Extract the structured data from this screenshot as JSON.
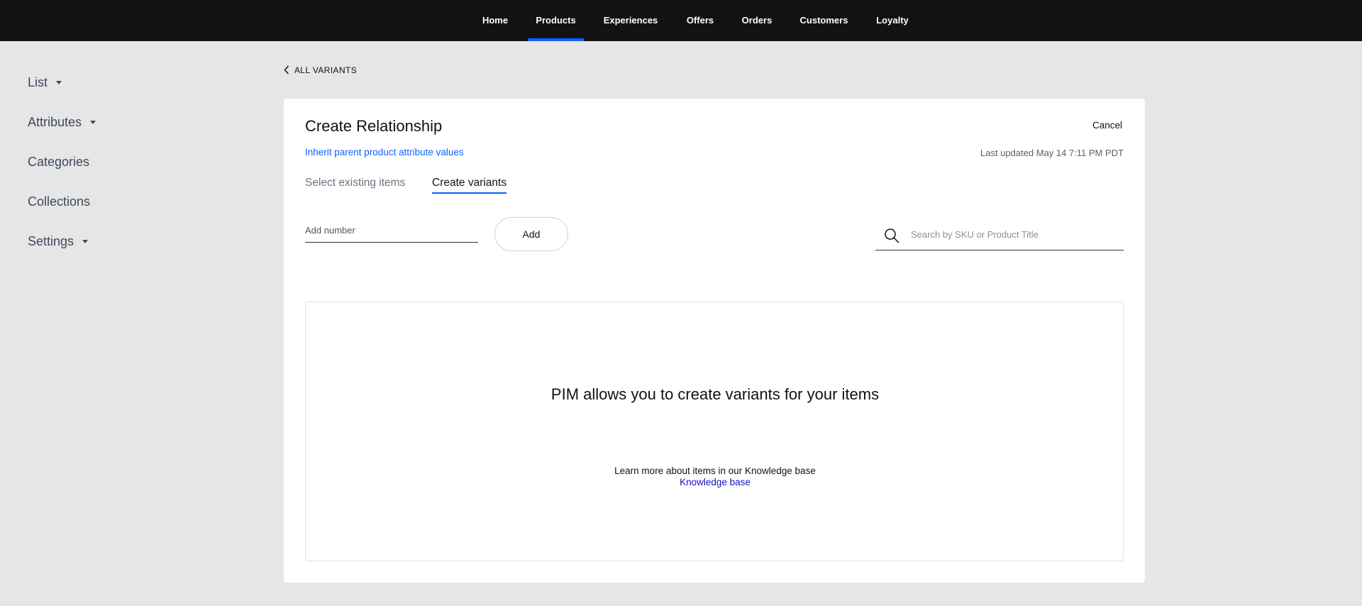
{
  "topnav": {
    "items": [
      {
        "label": "Home"
      },
      {
        "label": "Products",
        "active": true
      },
      {
        "label": "Experiences"
      },
      {
        "label": "Offers"
      },
      {
        "label": "Orders"
      },
      {
        "label": "Customers"
      },
      {
        "label": "Loyalty"
      }
    ],
    "active_color": "#0d62ff"
  },
  "sidebar": {
    "items": [
      {
        "label": "List",
        "has_dropdown": true
      },
      {
        "label": "Attributes",
        "has_dropdown": true
      },
      {
        "label": "Categories",
        "has_dropdown": false
      },
      {
        "label": "Collections",
        "has_dropdown": false
      },
      {
        "label": "Settings",
        "has_dropdown": true
      }
    ]
  },
  "breadcrumb": {
    "icon": "chevron-left-icon",
    "label": "ALL VARIANTS"
  },
  "card": {
    "title": "Create Relationship",
    "inherit_link": "Inherit parent product attribute values",
    "cancel_label": "Cancel",
    "last_updated": "Last updated May 14 7:11 PM PDT",
    "tabs": [
      {
        "label": "Select existing items",
        "active": false
      },
      {
        "label": "Create variants",
        "active": true
      }
    ],
    "add_number": {
      "placeholder": "Add number",
      "value": ""
    },
    "add_button_label": "Add",
    "search": {
      "placeholder": "Search by SKU or Product Title",
      "value": "",
      "icon": "search-icon"
    },
    "empty_state": {
      "heading": "PIM allows you to create variants for your items",
      "subtext": "Learn more about items in our Knowledge base",
      "link_label": "Knowledge base"
    }
  }
}
